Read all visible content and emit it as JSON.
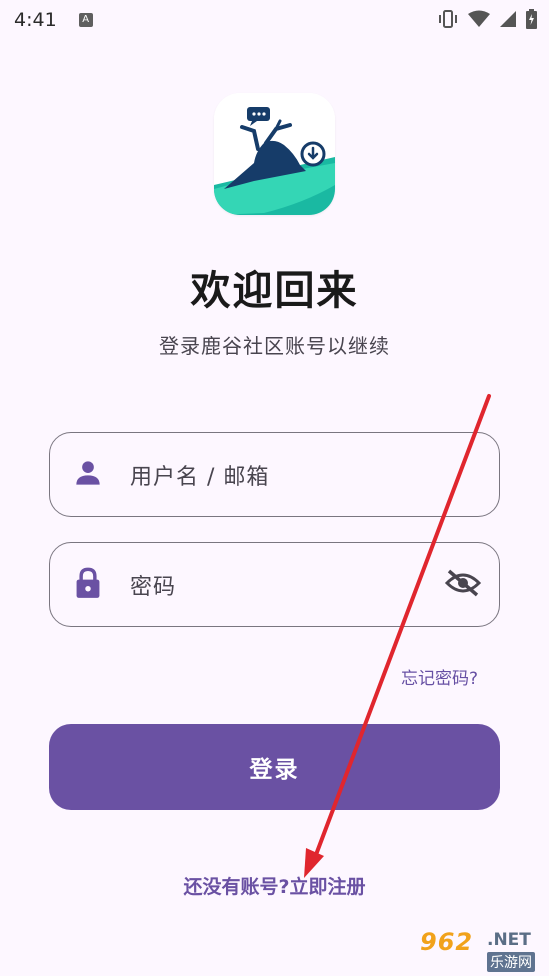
{
  "status_bar": {
    "time": "4:41",
    "notification_icon_letter": "A",
    "icons": [
      "vibrate-icon",
      "wifi-icon",
      "signal-icon",
      "battery-charging-icon"
    ]
  },
  "app": {
    "logo_icon": "deer-logo-icon",
    "title": "欢迎回来",
    "subtitle": "登录鹿谷社区账号以继续"
  },
  "form": {
    "username_placeholder": "用户名 / 邮箱",
    "password_placeholder": "密码",
    "forgot_password": "忘记密码?",
    "login_button": "登录",
    "register_prompt": "还没有账号?",
    "register_link": "立即注册"
  },
  "watermark": {
    "brand": "962",
    "domain": ".NET",
    "sub": "乐游网"
  },
  "colors": {
    "background": "#fdf7ff",
    "primary": "#6a51a3",
    "annotation_arrow": "#e0262e"
  }
}
